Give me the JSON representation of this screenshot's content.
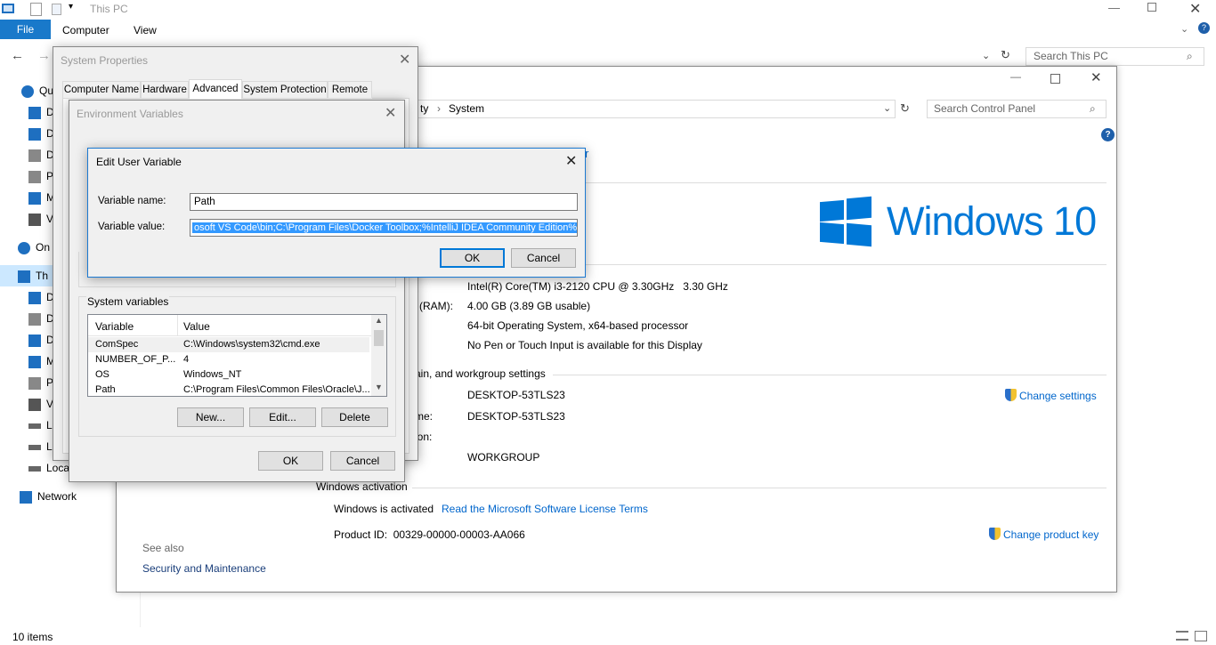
{
  "explorer": {
    "title": "This PC",
    "ribbon_tabs": [
      "File",
      "Computer",
      "View"
    ],
    "search_placeholder": "Search This PC",
    "status": "10 items",
    "nav": [
      {
        "label": "Qu",
        "icon": "star-icon"
      },
      {
        "label": "D",
        "icon": "desktop-icon"
      },
      {
        "label": "D",
        "icon": "download-icon"
      },
      {
        "label": "D",
        "icon": "document-icon"
      },
      {
        "label": "P",
        "icon": "picture-icon"
      },
      {
        "label": "M",
        "icon": "music-icon"
      },
      {
        "label": "V",
        "icon": "video-icon"
      },
      {
        "label": "On",
        "icon": "cloud-icon"
      },
      {
        "label": "Th",
        "icon": "pc-icon"
      },
      {
        "label": "D",
        "icon": "desktop-icon"
      },
      {
        "label": "D",
        "icon": "document-icon"
      },
      {
        "label": "D",
        "icon": "download-icon"
      },
      {
        "label": "M",
        "icon": "music-icon"
      },
      {
        "label": "P",
        "icon": "picture-icon"
      },
      {
        "label": "V",
        "icon": "video-icon"
      },
      {
        "label": "L",
        "icon": "drive-icon"
      },
      {
        "label": "L",
        "icon": "drive-icon"
      },
      {
        "label": "Loca",
        "icon": "drive-icon"
      },
      {
        "label": "Network",
        "icon": "network-icon"
      }
    ]
  },
  "control_panel": {
    "breadcrumb_partial": "ty",
    "breadcrumb_current": "System",
    "search_placeholder": "Search Control Panel",
    "windows_logo_text": "Windows 10",
    "processor": "Intel(R) Core(TM) i3-2120 CPU @ 3.30GHz   3.30 GHz",
    "ram_label": "(RAM):",
    "ram": "4.00 GB (3.89 GB usable)",
    "system_type": "64-bit Operating System, x64-based processor",
    "pen_touch": "No Pen or Touch Input is available for this Display",
    "section_name": "ain, and workgroup settings",
    "computer_name": "DESKTOP-53TLS23",
    "full_name_label": "me:",
    "full_name": "DESKTOP-53TLS23",
    "description_label": "ion:",
    "workgroup": "WORKGROUP",
    "change_settings": "Change settings",
    "activation_header": "Windows activation",
    "activated": "Windows is activated",
    "license_link": "Read the Microsoft Software License Terms",
    "product_id": "Product ID:  00329-00000-00003-AA066",
    "change_key": "Change product key",
    "see_also": "See also",
    "security": "Security and Maintenance",
    "partial_link": "r"
  },
  "system_properties": {
    "title": "System Properties",
    "tabs": [
      "Computer Name",
      "Hardware",
      "Advanced",
      "System Protection",
      "Remote"
    ],
    "active_tab": "Advanced"
  },
  "env_vars": {
    "title": "Environment Variables",
    "system_header": "System variables",
    "columns": [
      "Variable",
      "Value"
    ],
    "rows": [
      {
        "name": "ComSpec",
        "value": "C:\\Windows\\system32\\cmd.exe"
      },
      {
        "name": "NUMBER_OF_P...",
        "value": "4"
      },
      {
        "name": "OS",
        "value": "Windows_NT"
      },
      {
        "name": "Path",
        "value": "C:\\Program Files\\Common Files\\Oracle\\J..."
      }
    ],
    "new_btn": "New...",
    "edit_btn": "Edit...",
    "delete_btn": "Delete",
    "ok_btn": "OK",
    "cancel_btn": "Cancel"
  },
  "edit_var": {
    "title": "Edit User Variable",
    "name_label": "Variable name:",
    "name_value": "Path",
    "value_label": "Variable value:",
    "value_value": "osoft VS Code\\bin;C:\\Program Files\\Docker Toolbox;%IntelliJ IDEA Community Edition%",
    "ok_btn": "OK",
    "cancel_btn": "Cancel"
  },
  "colors": {
    "accent": "#0078d7",
    "link": "#0066cc",
    "selection": "#3399ff"
  }
}
